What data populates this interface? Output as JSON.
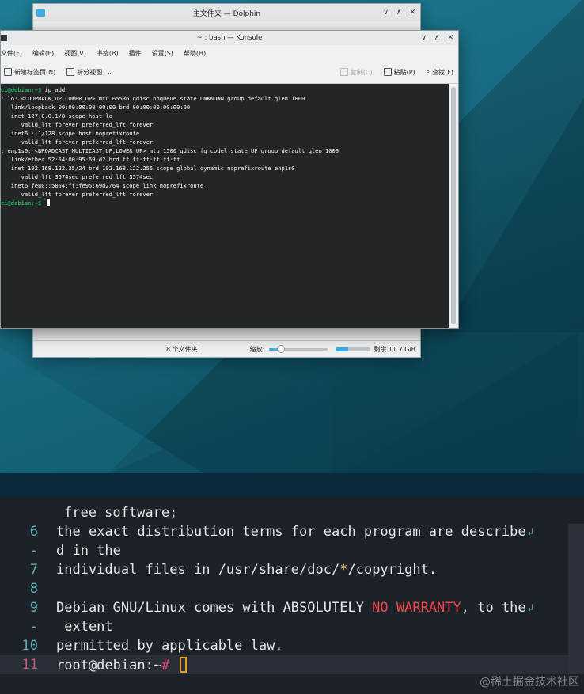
{
  "dolphin": {
    "title": "主文件夹 — Dolphin",
    "controls": {
      "min": "∨",
      "max": "∧",
      "close": "✕"
    },
    "status": {
      "count": "8 个文件夹",
      "zoom_label": "缩放:",
      "zoom_level": 0.2,
      "space_used": 0.35,
      "free": "剩余 11.7 GiB"
    }
  },
  "konsole": {
    "title": "~ : bash — Konsole",
    "controls": {
      "min": "∨",
      "max": "∧",
      "close": "✕"
    },
    "menu": [
      "文件(F)",
      "编辑(E)",
      "视图(V)",
      "书签(B)",
      "插件",
      "设置(S)",
      "帮助(H)"
    ],
    "toolbar": {
      "new_tab": "新建标签页(N)",
      "split": "拆分视图",
      "copy": "复制(C)",
      "paste": "粘贴(P)",
      "find": "查找(F)"
    },
    "terminal_lines": [
      {
        "prompt": "ci@debian:~$",
        "text": " ip addr"
      },
      {
        "prompt": "",
        "text": ": lo: <LOOPBACK,UP,LOWER_UP> mtu 65536 qdisc noqueue state UNKNOWN group default qlen 1000"
      },
      {
        "prompt": "",
        "text": "   link/loopback 00:00:00:00:00:00 brd 00:00:00:00:00:00"
      },
      {
        "prompt": "",
        "text": "   inet 127.0.0.1/8 scope host lo"
      },
      {
        "prompt": "",
        "text": "      valid_lft forever preferred_lft forever"
      },
      {
        "prompt": "",
        "text": "   inet6 ::1/128 scope host noprefixroute"
      },
      {
        "prompt": "",
        "text": "      valid_lft forever preferred_lft forever"
      },
      {
        "prompt": "",
        "text": ": enp1s0: <BROADCAST,MULTICAST,UP,LOWER_UP> mtu 1500 qdisc fq_codel state UP group default qlen 1000"
      },
      {
        "prompt": "",
        "text": "   link/ether 52:54:00:95:69:d2 brd ff:ff:ff:ff:ff:ff"
      },
      {
        "prompt": "",
        "text": "   inet 192.168.122.35/24 brd 192.168.122.255 scope global dynamic noprefixroute enp1s0"
      },
      {
        "prompt": "",
        "text": "      valid_lft 3574sec preferred_lft 3574sec"
      },
      {
        "prompt": "",
        "text": "   inet6 fe80::5054:ff:fe95:69d2/64 scope link noprefixroute"
      },
      {
        "prompt": "",
        "text": "      valid_lft forever preferred_lft forever"
      },
      {
        "prompt": "ci@debian:~$",
        "text": " "
      }
    ]
  },
  "editor": {
    "lines": [
      {
        "num": "",
        "parts": [
          {
            "t": "free software;",
            "c": ""
          }
        ],
        "wrap": false,
        "indent": true
      },
      {
        "num": "6",
        "parts": [
          {
            "t": "the exact distribution terms for each program are describe",
            "c": ""
          }
        ],
        "wrap": true
      },
      {
        "num": "-",
        "parts": [
          {
            "t": "d in the",
            "c": ""
          }
        ],
        "wrap": false
      },
      {
        "num": "7",
        "parts": [
          {
            "t": "individual files in /usr/share/doc/",
            "c": ""
          },
          {
            "t": "*",
            "c": "yellow"
          },
          {
            "t": "/copyright.",
            "c": ""
          }
        ],
        "wrap": false
      },
      {
        "num": "8",
        "parts": [
          {
            "t": "",
            "c": ""
          }
        ],
        "wrap": false
      },
      {
        "num": "9",
        "parts": [
          {
            "t": "Debian GNU/Linux comes with ABSOLUTELY ",
            "c": ""
          },
          {
            "t": "NO WARRANTY",
            "c": "red"
          },
          {
            "t": ", to the",
            "c": ""
          }
        ],
        "wrap": true
      },
      {
        "num": "-",
        "parts": [
          {
            "t": " extent",
            "c": ""
          }
        ],
        "wrap": false
      },
      {
        "num": "10",
        "parts": [
          {
            "t": "permitted by applicable law.",
            "c": ""
          }
        ],
        "wrap": false
      },
      {
        "num": "11",
        "parts": [
          {
            "t": "root@debian:~",
            "c": ""
          },
          {
            "t": "#",
            "c": "pink"
          },
          {
            "t": " ",
            "c": ""
          }
        ],
        "wrap": false,
        "current": true
      }
    ],
    "wrap_glyph": "↲"
  },
  "watermark": "@稀土掘金技术社区"
}
